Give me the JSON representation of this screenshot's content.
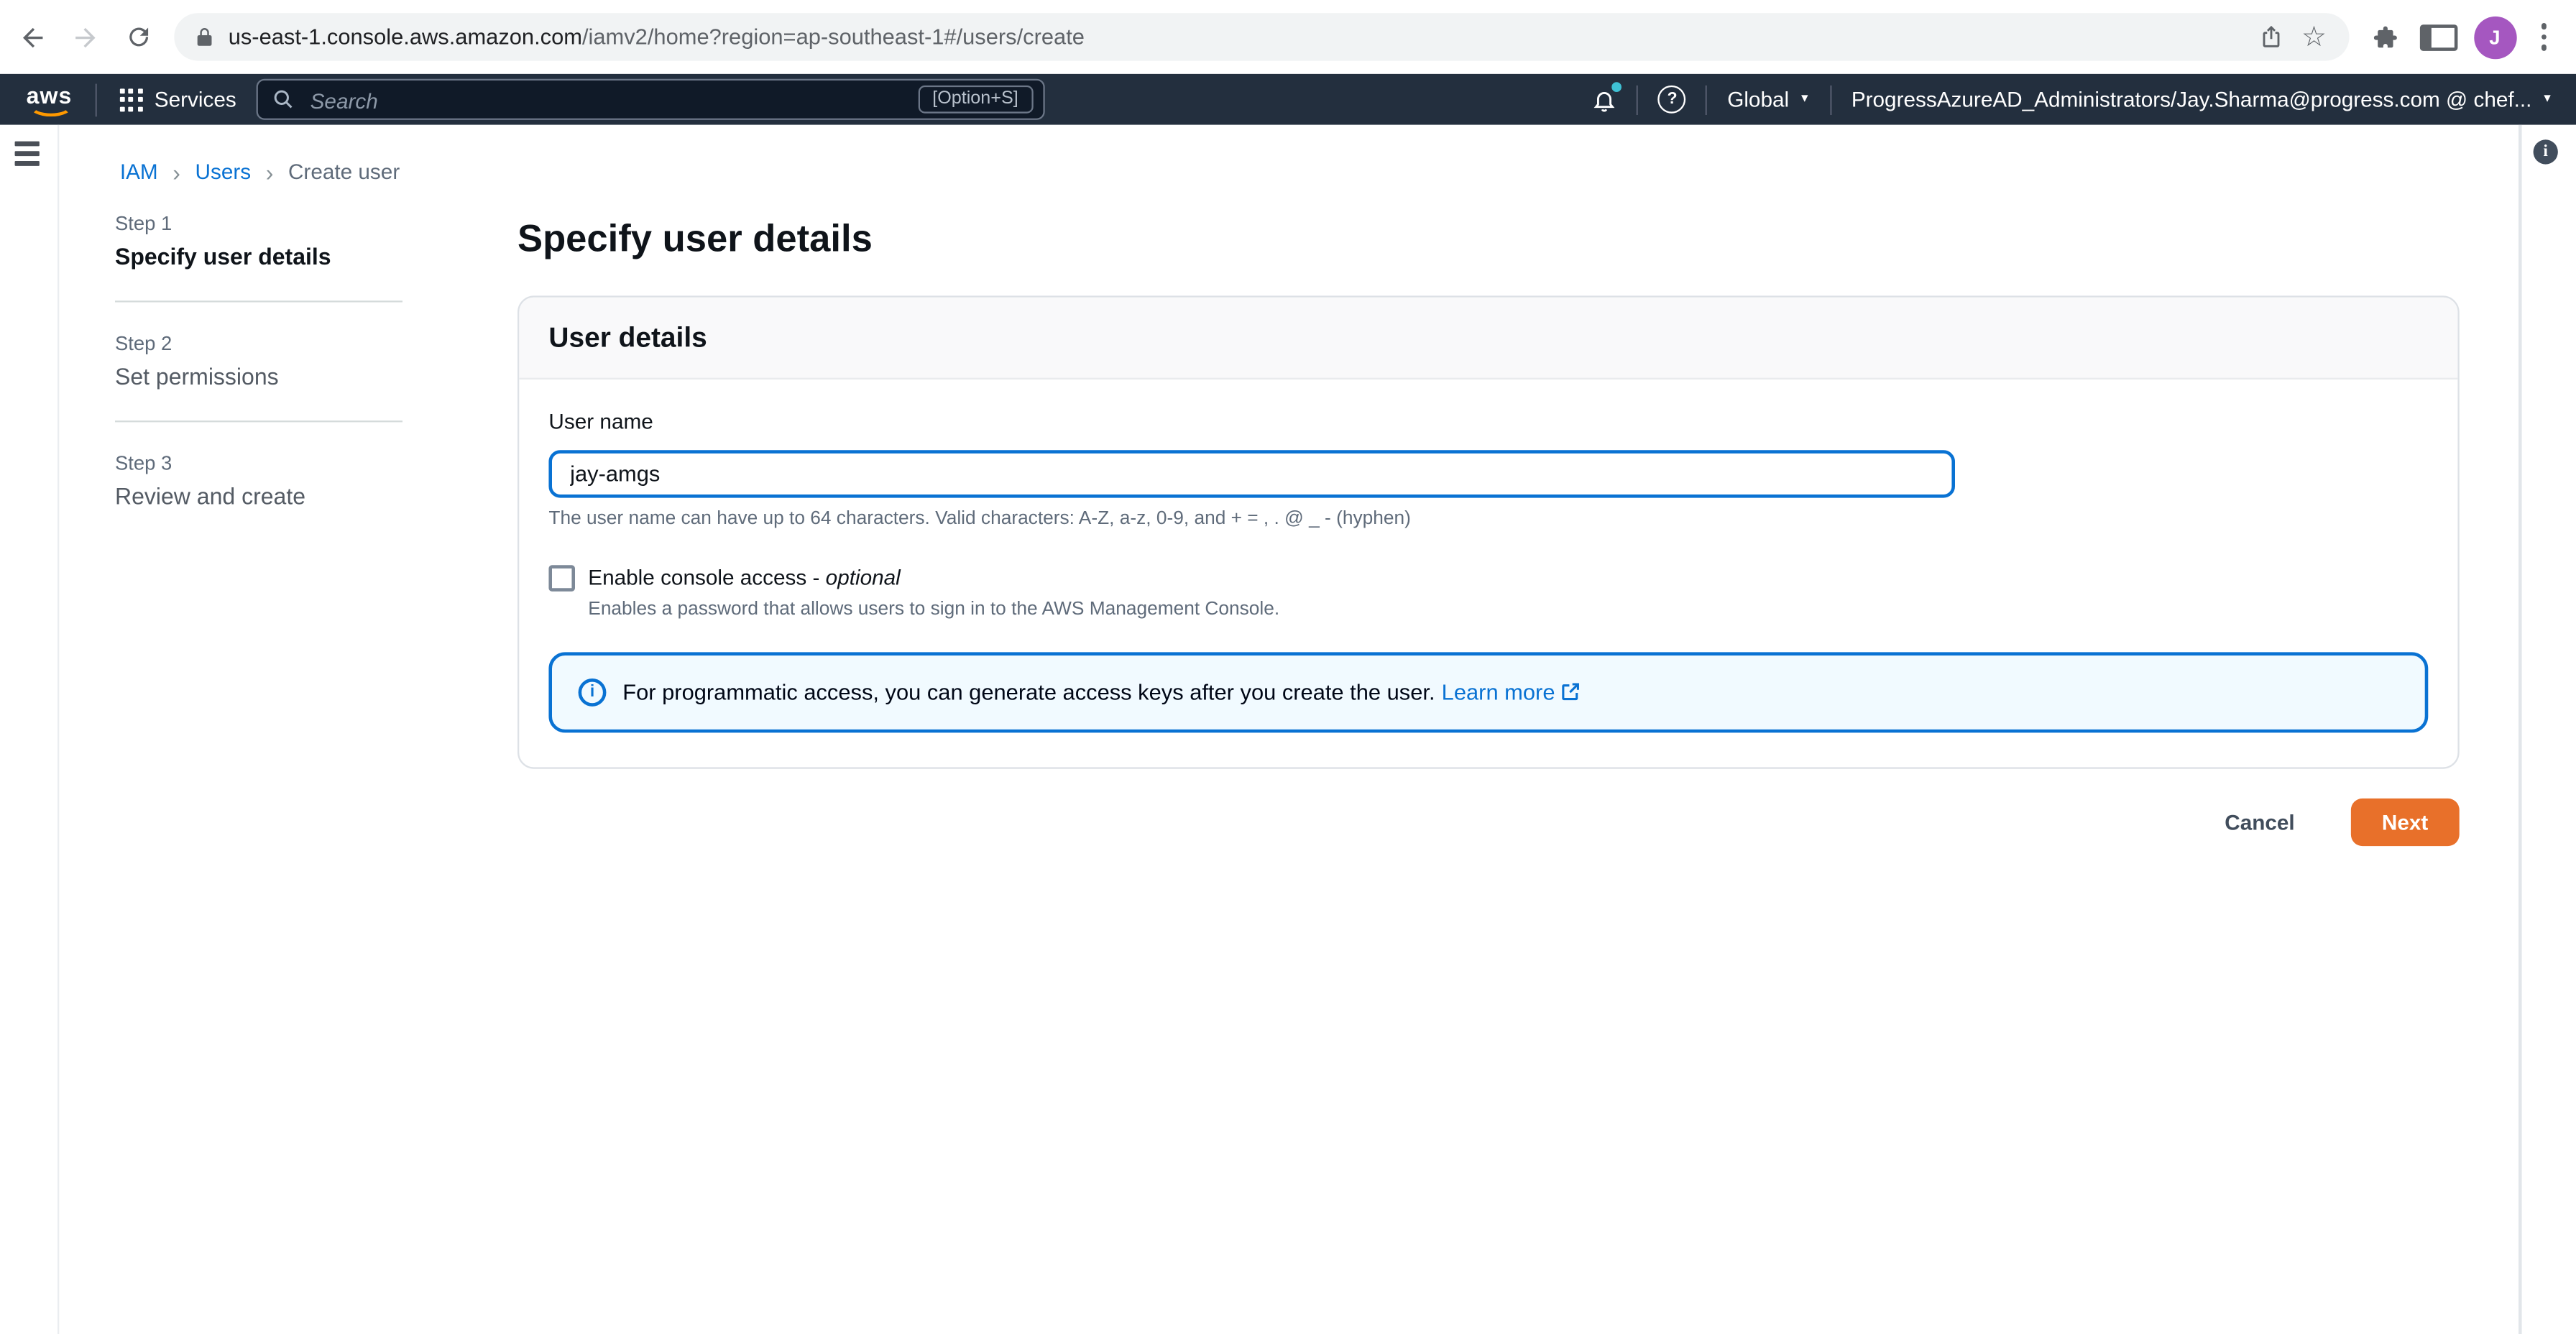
{
  "browser": {
    "url_domain": "us-east-1.console.aws.amazon.com",
    "url_path": "/iamv2/home?region=ap-southeast-1#/users/create",
    "avatar_initial": "J"
  },
  "nav": {
    "logo_text": "aws",
    "services_label": "Services",
    "search_placeholder": "Search",
    "shortcut_hint": "[Option+S]",
    "region_label": "Global",
    "account_label": "ProgressAzureAD_Administrators/Jay.Sharma@progress.com @ chef..."
  },
  "glyphs": {
    "star": "☆",
    "question_mark": "?",
    "info_letter": "i",
    "caret_down": "▼",
    "breadcrumb_sep": "›"
  },
  "breadcrumb": {
    "items": [
      {
        "label": "IAM"
      },
      {
        "label": "Users"
      },
      {
        "label": "Create user"
      }
    ]
  },
  "steps": {
    "items": [
      {
        "step": "Step 1",
        "title": "Specify user details"
      },
      {
        "step": "Step 2",
        "title": "Set permissions"
      },
      {
        "step": "Step 3",
        "title": "Review and create"
      }
    ]
  },
  "page": {
    "title": "Specify user details",
    "card_header": "User details",
    "username_label": "User name",
    "username_value": "jay-amgs",
    "username_constraint": "The user name can have up to 64 characters. Valid characters: A-Z, a-z, 0-9, and + = , . @ _ - (hyphen)",
    "console_access_label": "Enable console access -",
    "console_access_optional": "optional",
    "console_access_description": "Enables a password that allows users to sign in to the AWS Management Console.",
    "alert_message": "For programmatic access, you can generate access keys after you create the user.",
    "alert_link_label": "Learn more",
    "cancel_label": "Cancel",
    "next_label": "Next"
  },
  "colors": {
    "nav_bar": "#232f3e",
    "aws_orange": "#ff9900",
    "link_blue": "#0972d3",
    "primary_button": "#e8702a",
    "notification_dot": "#3fc1d4",
    "avatar_purple": "#a557c0",
    "alert_background": "#f1faff"
  }
}
